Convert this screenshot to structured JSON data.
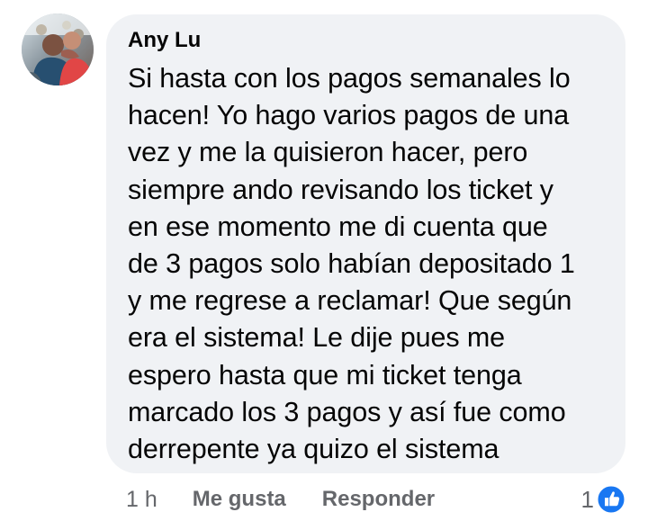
{
  "comment": {
    "author": "Any Lu",
    "text": "Si hasta con los pagos semanales lo\nhacen! Yo hago varios pagos de una\nvez y me la quisieron hacer, pero\nsiempre ando revisando los ticket y\nen ese momento me di cuenta que\nde 3 pagos solo habían depositado 1\ny me regrese a reclamar! Que según\nera el sistema! Le dije pues me\nespero hasta que mi ticket tenga\nmarcado los 3 pagos y así fue como\nderrepente ya quizo el sistema",
    "timestamp": "1 h",
    "like_label": "Me gusta",
    "reply_label": "Responder",
    "reaction_count": "1",
    "reaction_icon": "thumbs-up-icon"
  },
  "colors": {
    "bubble": "#f0f2f5",
    "text": "#050505",
    "meta": "#65676b",
    "reaction_blue": "#1877f2"
  }
}
